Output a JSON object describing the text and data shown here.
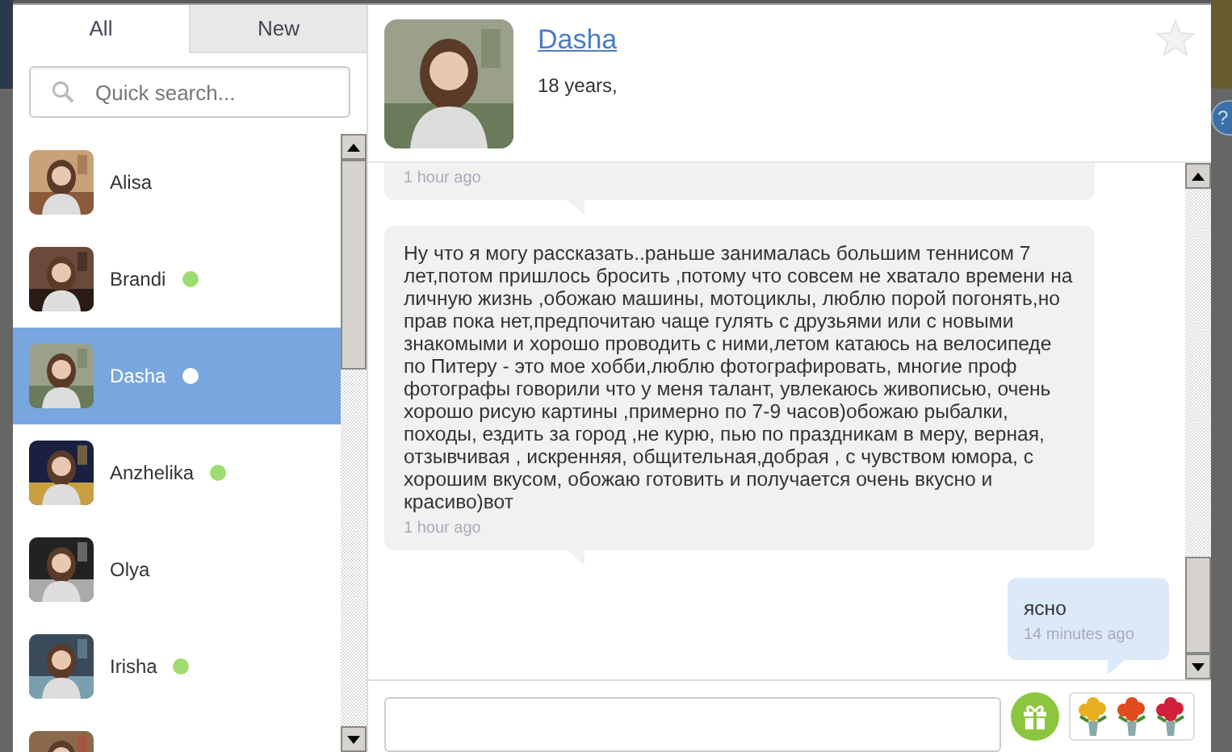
{
  "tabs": [
    {
      "label": "All",
      "selected": true
    },
    {
      "label": "New",
      "selected": false
    }
  ],
  "search": {
    "placeholder": "Quick search..."
  },
  "contacts": [
    {
      "name": "Alisa",
      "online": false,
      "selected": false
    },
    {
      "name": "Brandi",
      "online": true,
      "selected": false
    },
    {
      "name": "Dasha",
      "online": true,
      "selected": true
    },
    {
      "name": "Anzhelika",
      "online": true,
      "selected": false
    },
    {
      "name": "Olya",
      "online": false,
      "selected": false
    },
    {
      "name": "Irisha",
      "online": true,
      "selected": false
    },
    {
      "online": false,
      "selected": false
    }
  ],
  "profile": {
    "name": "Dasha",
    "age": "18 years,",
    "favorite": false
  },
  "help_button": "?",
  "messages": [
    {
      "kind": "received",
      "time": "1 hour ago"
    },
    {
      "kind": "received",
      "text": "Ну что я могу рассказать..раньше занималась большим теннисом 7 лет,потом пришлось бросить ,потому что совсем не хватало времени на личную жизнь ,обожаю машины, мотоциклы, люблю порой погонять,но прав пока нет,предпочитаю чаще гулять с друзьями или с новыми знакомыми и хорошо проводить с ними,летом катаюсь на велосипеде по Питеру - это мое хобби,люблю фотографировать, многие проф фотографы говорили что у меня талант, увлекаюсь живописью, очень хорошо рисую картины ,примерно по 7-9 часов)обожаю рыбалки, походы, ездить за город ,не курю, пью по праздникам в меру, верная, отзывчивая , искренняя, общительная,добрая , с чувством юмора, с хорошим вкусом, обожаю готовить и получается очень вкусно и красиво)вот",
      "time": "1 hour ago"
    },
    {
      "kind": "sent",
      "text": "ясно",
      "time": "14 minutes ago"
    }
  ],
  "gifts": [
    {
      "color": "#e8b020"
    },
    {
      "color": "#e04a1c"
    },
    {
      "color": "#d0203a"
    }
  ]
}
